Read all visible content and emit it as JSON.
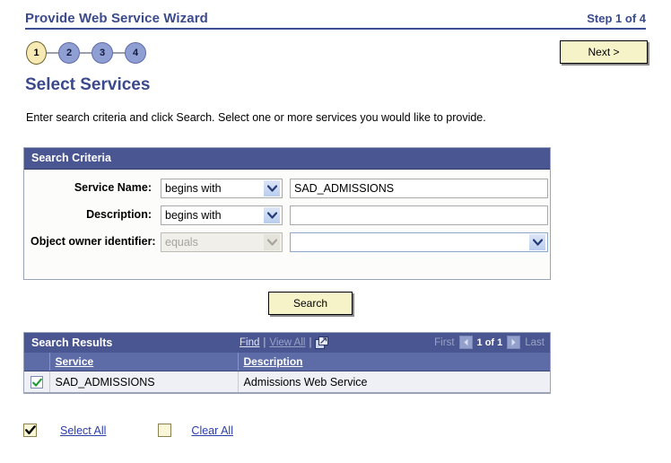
{
  "header": {
    "title": "Provide Web Service Wizard",
    "step_label": "Step 1 of 4",
    "next_button": "Next >"
  },
  "steps": [
    {
      "number": "1",
      "state": "active"
    },
    {
      "number": "2",
      "state": "inactive"
    },
    {
      "number": "3",
      "state": "inactive"
    },
    {
      "number": "4",
      "state": "inactive"
    }
  ],
  "page": {
    "title": "Select Services",
    "instructions": "Enter search criteria and click Search. Select one or more services you would like to provide."
  },
  "search_criteria": {
    "panel_title": "Search Criteria",
    "rows": [
      {
        "label": "Service Name:",
        "operator": "begins with",
        "operator_disabled": false,
        "value": "SAD_ADMISSIONS",
        "value_type": "text"
      },
      {
        "label": "Description:",
        "operator": "begins with",
        "operator_disabled": false,
        "value": "",
        "value_type": "text"
      },
      {
        "label": "Object owner identifier:",
        "operator": "equals",
        "operator_disabled": true,
        "value": "",
        "value_type": "select"
      }
    ],
    "search_button": "Search"
  },
  "search_results": {
    "panel_title": "Search Results",
    "grid_links": {
      "find": "Find",
      "separator": "|",
      "view_all": "View All",
      "download_icon": "download-grid-icon"
    },
    "pager": {
      "first": "First",
      "prev_icon": "previous-page-icon",
      "count": "1 of 1",
      "next_icon": "next-page-icon",
      "last": "Last"
    },
    "columns": [
      "",
      "Service",
      "Description"
    ],
    "rows": [
      {
        "selected": true,
        "service": "SAD_ADMISSIONS",
        "description": "Admissions Web Service"
      }
    ]
  },
  "bottom_actions": {
    "select_all_checked": true,
    "select_all_label": "Select All",
    "clear_all_checked": false,
    "clear_all_label": "Clear All"
  },
  "colors": {
    "brand_blue": "#3b4a8c",
    "panel_header": "#4a5691",
    "grid_header": "#5d6ca6",
    "button_face": "#f6f3c8",
    "link_blue": "#2c3ea8",
    "check_green": "#1f9b3a",
    "active_step": "#f7eab4",
    "inactive_step": "#8f9fd4"
  }
}
